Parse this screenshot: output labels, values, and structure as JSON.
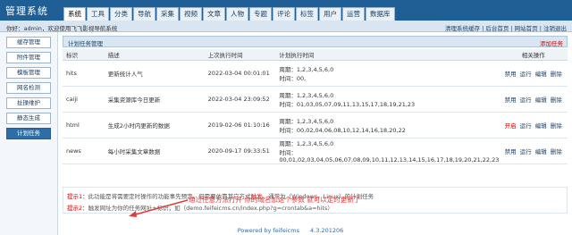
{
  "header": {
    "title": "管理系统",
    "nav": [
      "系统",
      "工具",
      "分类",
      "导航",
      "采集",
      "视频",
      "文章",
      "人物",
      "专题",
      "评论",
      "标签",
      "用户",
      "运营",
      "数据库"
    ],
    "active_nav": "系统"
  },
  "subbar": {
    "welcome": "你好：admin，欢迎使用飞飞影视导航系统",
    "links": [
      "清理系统缓存",
      "后台首页",
      "网站首页",
      "注销退出"
    ]
  },
  "sidebar": {
    "items": [
      "缓存管理",
      "附件管理",
      "模板管理",
      "网名检测",
      "扯操维护",
      "静态生成",
      "计划任务"
    ],
    "active": "计划任务"
  },
  "panel": {
    "title": "计划任务管理",
    "add_label": "添加任务"
  },
  "table": {
    "headers": [
      "标识",
      "描述",
      "上次执行时间",
      "计划执行时间",
      "相关操作"
    ],
    "rows": [
      {
        "id": "hits",
        "desc": "更新统计人气",
        "last": "2022-03-04 00:01:01",
        "plan_week": "周期：1,2,3,4,5,6,0",
        "plan_time": "时间：00,",
        "ops": [
          "禁用",
          "运行",
          "编辑",
          "删除"
        ],
        "first_red": false
      },
      {
        "id": "caiji",
        "desc": "采集资源库今日更新",
        "last": "2022-03-04 23:09:52",
        "plan_week": "周期：1,2,3,4,5,6,0",
        "plan_time": "时间：01,03,05,07,09,11,13,15,17,18,19,21,23",
        "ops": [
          "禁用",
          "运行",
          "编辑",
          "删除"
        ],
        "first_red": false
      },
      {
        "id": "html",
        "desc": "生成2小时内更新的数据",
        "last": "2019-02-06 01:10:16",
        "plan_week": "周期：1,2,3,4,5,6,0",
        "plan_time": "时间：00,02,04,06,08,10,12,14,16,18,20,22",
        "ops": [
          "开启",
          "运行",
          "编辑",
          "删除"
        ],
        "first_red": true
      },
      {
        "id": "news",
        "desc": "每小时采集文章数据",
        "last": "2020-09-17 09:33:51",
        "plan_week": "周期：1,2,3,4,5,6,0",
        "plan_time": "时间：00,01,02,03,04,05,06,07,08,09,10,11,12,13,14,15,16,17,18,19,20,21,22,23",
        "ops": [
          "禁用",
          "运行",
          "编辑",
          "删除"
        ],
        "first_red": false
      }
    ]
  },
  "tips": {
    "tip1_label": "提示1：",
    "tip1_pre": "此功能是将需要定时操作的功能事先预定，但需要依靠其它方式",
    "tip1_em": "触发",
    "tip1_post": "，通常为（Windows、Linux）的计划任务",
    "tip2_label": "提示2：",
    "tip2_text": "触发网址为你的任务网址+标识，如（demo.feifeicms.cn/index.php?g=crontab&a=hits）"
  },
  "annotation": "通过任意方法打开 你的域名加这个参数 就可以定时更新了",
  "footer": {
    "powered": "Powered by feifeicms",
    "version": "4.3.201206"
  },
  "colors": {
    "header_bg": "#1f5f95",
    "accent_red": "#d40000",
    "annotation_red": "#e23b3b"
  }
}
